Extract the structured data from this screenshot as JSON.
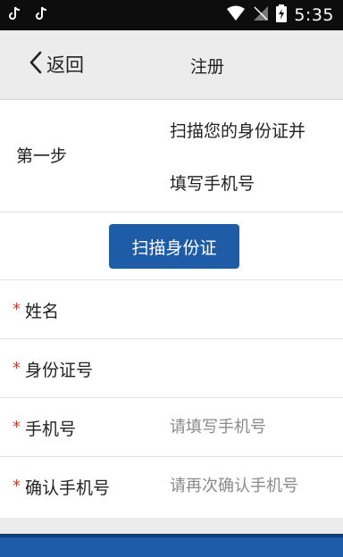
{
  "status_bar": {
    "time": "5:35"
  },
  "nav": {
    "back_label": "返回",
    "title": "注册"
  },
  "step": {
    "label": "第一步",
    "description_line1": "扫描您的身份证并",
    "description_line2": "填写手机号"
  },
  "scan_button": {
    "label": "扫描身份证"
  },
  "form": {
    "required_mark": "*",
    "fields": [
      {
        "label": "姓名",
        "placeholder": ""
      },
      {
        "label": "身份证号",
        "placeholder": ""
      },
      {
        "label": "手机号",
        "placeholder": "请填写手机号"
      },
      {
        "label": "确认手机号",
        "placeholder": "请再次确认手机号"
      }
    ]
  },
  "colors": {
    "primary": "#1e5ca8",
    "required": "#d63a2f"
  }
}
